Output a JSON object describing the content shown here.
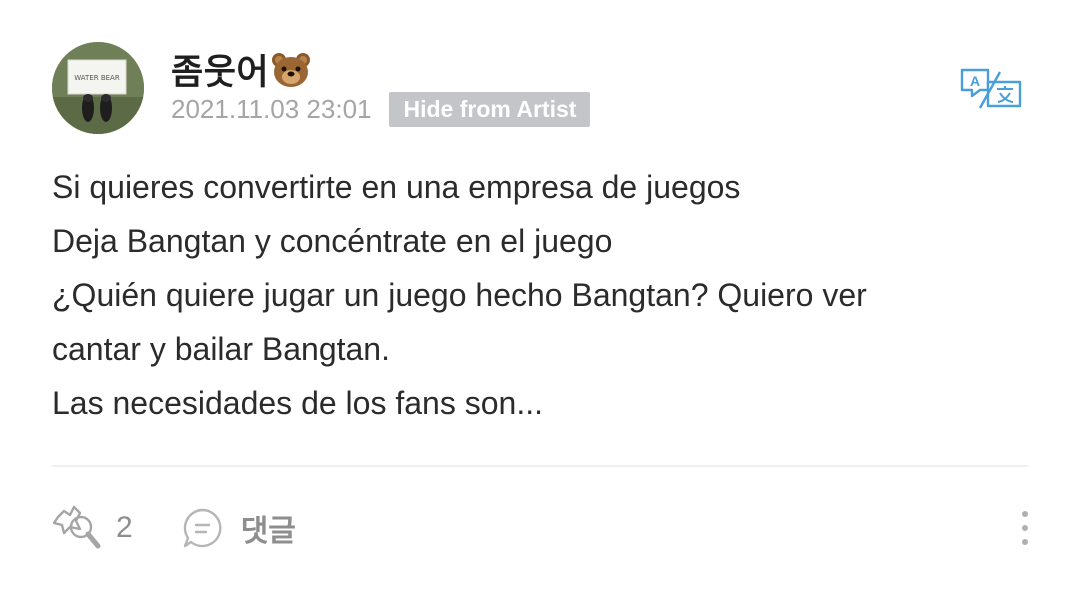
{
  "post": {
    "author": {
      "name": "좀웃어",
      "emoji_icon": "bear-face-icon",
      "avatar_sign_text": "WATER BEAR"
    },
    "timestamp": "2021.11.03 23:01",
    "hide_label": "Hide from Artist",
    "translate_icon": "translate-icon",
    "body_lines": [
      "Si quieres convertirte en una empresa de juegos",
      "Deja Bangtan y concéntrate en el juego",
      "¿Quién quiere jugar un juego hecho Bangtan? Quiero ver",
      "cantar y bailar Bangtan.",
      "Las necesidades de los fans son..."
    ]
  },
  "actions": {
    "like_icon": "cheer-stick-icon",
    "like_count": "2",
    "comment_icon": "comment-bubble-icon",
    "comment_label": "댓글",
    "more_icon": "more-vertical-icon"
  },
  "colors": {
    "accent_blue": "#4a9fd8",
    "muted_gray": "#a5a5a5",
    "badge_gray": "#c3c5c8",
    "text_dark": "#2b2b2b"
  }
}
